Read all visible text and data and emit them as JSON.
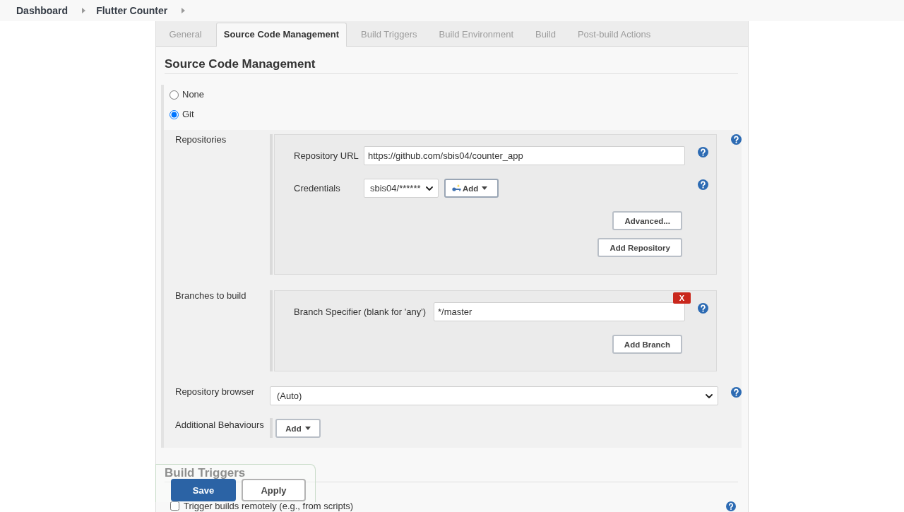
{
  "breadcrumb": [
    {
      "label": "Dashboard"
    },
    {
      "label": "Flutter Counter"
    }
  ],
  "tabs": [
    {
      "label": "General",
      "selected": false
    },
    {
      "label": "Source Code Management",
      "selected": true
    },
    {
      "label": "Build Triggers",
      "selected": false
    },
    {
      "label": "Build Environment",
      "selected": false
    },
    {
      "label": "Build",
      "selected": false
    },
    {
      "label": "Post-build Actions",
      "selected": false
    }
  ],
  "scm": {
    "title": "Source Code Management",
    "options": [
      {
        "label": "None",
        "selected": false
      },
      {
        "label": "Git",
        "selected": true
      }
    ],
    "repositories": {
      "label": "Repositories",
      "fields": [
        {
          "kind": "text",
          "label": "Repository URL",
          "value": "https://github.com/sbis04/counter_app"
        },
        {
          "kind": "select",
          "label": "Credentials",
          "value": "sbis04/******",
          "add_button": "Add"
        }
      ],
      "buttons": [
        "Advanced...",
        "Add Repository"
      ]
    },
    "branches": {
      "label": "Branches to build",
      "delete_button": "X",
      "field": {
        "label": "Branch Specifier (blank for 'any')",
        "value": "*/master"
      },
      "button": "Add Branch"
    },
    "repository_browser": {
      "label": "Repository browser",
      "value": "(Auto)"
    },
    "additional_behaviours": {
      "label": "Additional Behaviours",
      "button": "Add"
    }
  },
  "build_triggers": {
    "title": "Build Triggers",
    "options": [
      {
        "label": "Trigger builds remotely (e.g., from scripts)",
        "checked": false
      }
    ]
  },
  "actions": [
    {
      "label": "Save",
      "kind": "primary"
    },
    {
      "label": "Apply",
      "kind": "secondary"
    }
  ]
}
